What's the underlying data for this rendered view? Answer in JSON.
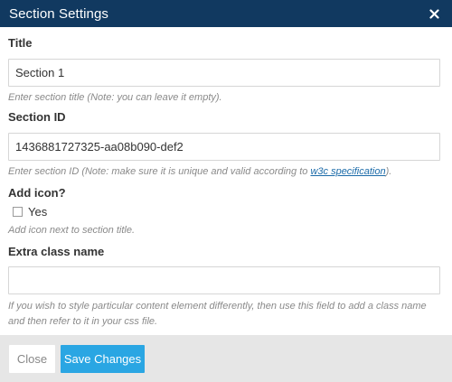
{
  "header": {
    "title": "Section Settings",
    "close_icon": "close-icon"
  },
  "fields": {
    "title": {
      "label": "Title",
      "value": "Section 1",
      "help": "Enter section title (Note: you can leave it empty)."
    },
    "section_id": {
      "label": "Section ID",
      "value": "1436881727325-aa08b090-def2",
      "help_before": "Enter section ID (Note: make sure it is unique and valid according to ",
      "help_link": "w3c specification",
      "help_after": ")."
    },
    "add_icon": {
      "label": "Add icon?",
      "checkbox_label": "Yes",
      "checked": false,
      "help": "Add icon next to section title."
    },
    "extra_class": {
      "label": "Extra class name",
      "value": "",
      "help": "If you wish to style particular content element differently, then use this field to add a class name and then refer to it in your css file."
    }
  },
  "footer": {
    "close_label": "Close",
    "save_label": "Save Changes"
  },
  "colors": {
    "header_bg": "#113960",
    "save_button_bg": "#2aa6e3",
    "link": "#1a6aa8",
    "footer_bg": "#e6e6e6"
  }
}
